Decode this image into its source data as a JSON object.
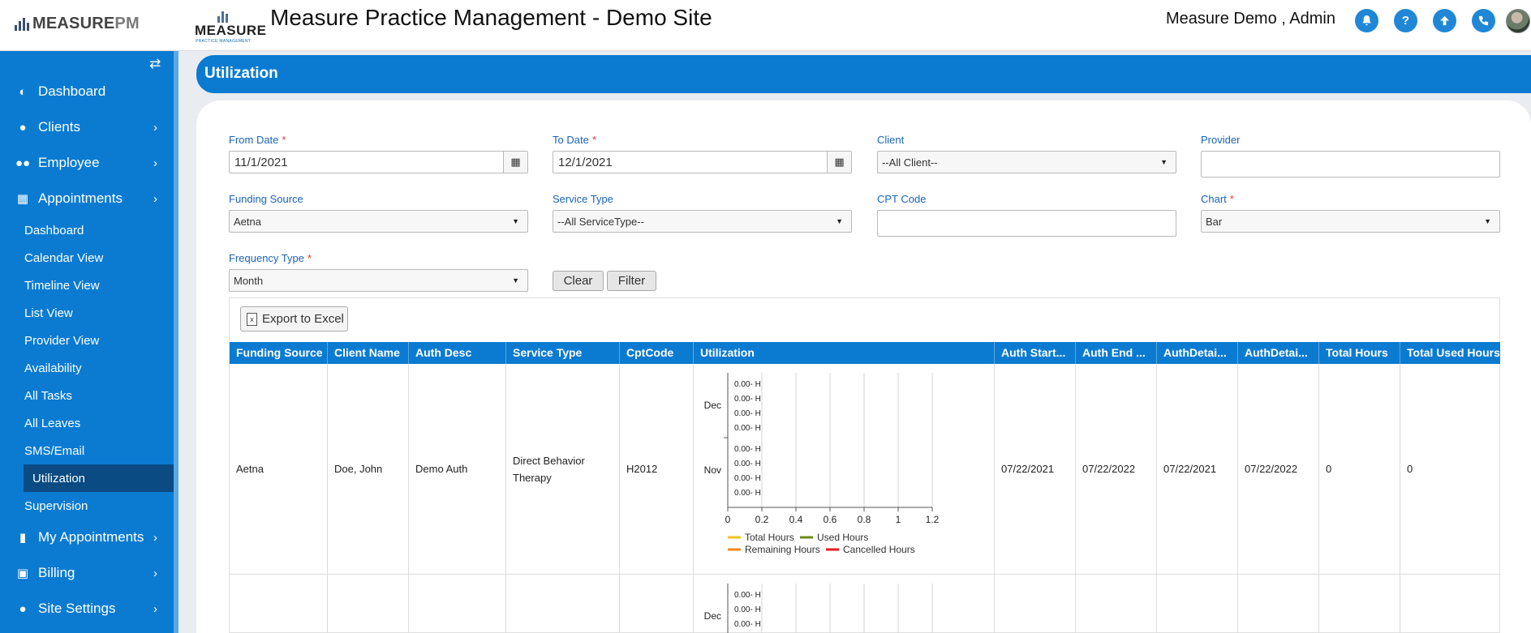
{
  "header": {
    "brand_main": "MEASURE",
    "brand_suffix": "PM",
    "logo_text": "MEASURE",
    "logo_sub": "PRACTICE MANAGEMENT",
    "app_title": "Measure Practice Management - Demo Site",
    "user": "Measure Demo , Admin",
    "icons": [
      "bell-icon",
      "help-icon",
      "upload-icon",
      "phone-icon"
    ],
    "accent_color": "#0a7bd1"
  },
  "sidebar": {
    "items": [
      {
        "label": "Dashboard",
        "icon": "dashboard-icon",
        "has_children": false
      },
      {
        "label": "Clients",
        "icon": "user-icon",
        "has_children": true
      },
      {
        "label": "Employee",
        "icon": "users-icon",
        "has_children": true
      },
      {
        "label": "Appointments",
        "icon": "calendar-icon",
        "has_children": true
      }
    ],
    "sub_items": [
      "Dashboard",
      "Calendar View",
      "Timeline View",
      "List View",
      "Provider View",
      "Availability",
      "All Tasks",
      "All Leaves",
      "SMS/Email",
      "Utilization",
      "Supervision"
    ],
    "active_sub": "Utilization",
    "bottom_items": [
      {
        "label": "My Appointments",
        "icon": "mobile-icon",
        "has_children": true
      },
      {
        "label": "Billing",
        "icon": "money-icon",
        "has_children": true
      },
      {
        "label": "Site Settings",
        "icon": "user-icon",
        "has_children": true
      }
    ]
  },
  "page": {
    "title": "Utilization"
  },
  "filters": {
    "from_date": {
      "label": "From Date",
      "value": "11/1/2021",
      "required": true
    },
    "to_date": {
      "label": "To Date",
      "value": "12/1/2021",
      "required": true
    },
    "client": {
      "label": "Client",
      "value": "--All Client--"
    },
    "provider": {
      "label": "Provider",
      "value": ""
    },
    "funding_source": {
      "label": "Funding Source",
      "value": "Aetna"
    },
    "service_type": {
      "label": "Service Type",
      "value": "--All ServiceType--"
    },
    "cpt_code": {
      "label": "CPT Code",
      "value": ""
    },
    "chart": {
      "label": "Chart",
      "value": "Bar",
      "required": true
    },
    "frequency_type": {
      "label": "Frequency Type",
      "value": "Month",
      "required": true
    },
    "clear_label": "Clear",
    "filter_label": "Filter",
    "required_mark": "*"
  },
  "grid": {
    "export_label": "Export to Excel",
    "columns": [
      "Funding Source",
      "Client Name",
      "Auth Desc",
      "Service Type",
      "CptCode",
      "Utilization",
      "Auth Start...",
      "Auth End ...",
      "AuthDetai...",
      "AuthDetai...",
      "Total Hours",
      "Total Used Hours"
    ],
    "rows": [
      {
        "funding_source": "Aetna",
        "client_name": "Doe, John",
        "auth_desc": "Demo Auth",
        "service_type": "Direct Behavior Therapy",
        "cpt_code": "H2012",
        "auth_start": "07/22/2021",
        "auth_end": "07/22/2022",
        "auth_detail_start": "07/22/2021",
        "auth_detail_end": "07/22/2022",
        "total_hours": "0",
        "total_used_hours": "0"
      }
    ]
  },
  "chart_data": {
    "type": "bar",
    "orientation": "horizontal",
    "categories": [
      "Dec",
      "Nov"
    ],
    "bar_label": "0.00- H",
    "xticks": [
      "0",
      "0.2",
      "0.4",
      "0.6",
      "0.8",
      "1",
      "1.2"
    ],
    "xlim": [
      0,
      1.2
    ],
    "grid": true,
    "legend_position": "bottom",
    "series": [
      {
        "name": "Total Hours",
        "color": "#f5c026",
        "values": [
          0,
          0
        ]
      },
      {
        "name": "Used Hours",
        "color": "#6e8a1d",
        "values": [
          0,
          0
        ]
      },
      {
        "name": "Remaining Hours",
        "color": "#f08a1c",
        "values": [
          0,
          0
        ]
      },
      {
        "name": "Cancelled Hours",
        "color": "#e8191f",
        "values": [
          0,
          0
        ]
      }
    ],
    "second_row_chart": {
      "categories": [
        "Dec"
      ],
      "bar_label": "0.00- H"
    }
  }
}
